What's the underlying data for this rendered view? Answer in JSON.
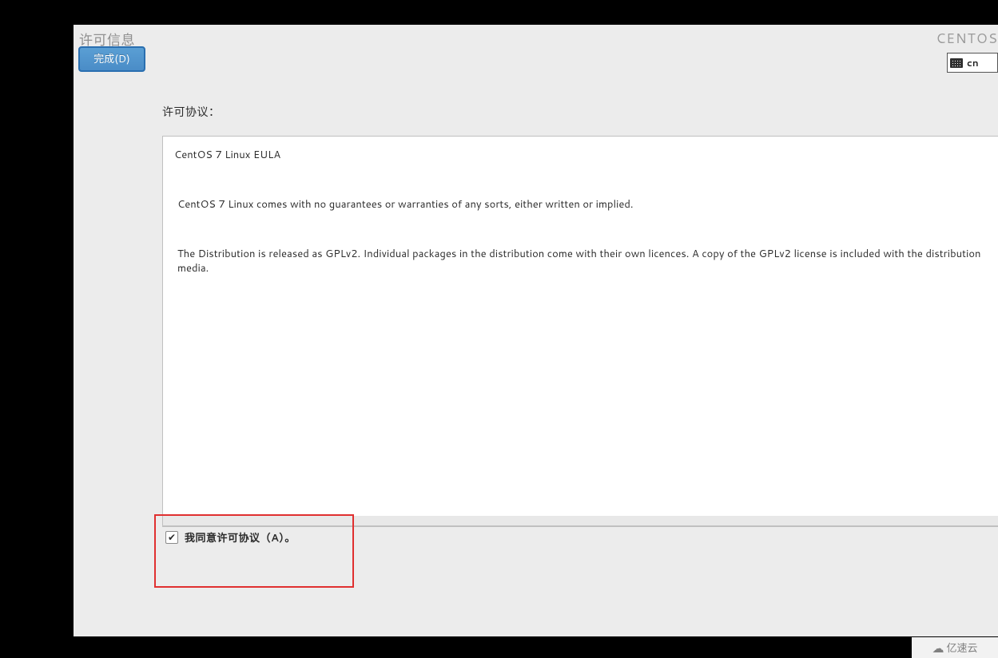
{
  "header": {
    "title": "许可信息",
    "done_button_label": "完成(D)",
    "brand": "CENTOS",
    "keyboard_layout": "cn"
  },
  "license": {
    "section_label": "许可协议：",
    "eula_title": "CentOS 7 Linux EULA",
    "paragraph1": "CentOS 7 Linux comes with no guarantees or warranties of any sorts, either written or implied.",
    "paragraph2": "The Distribution is released as GPLv2. Individual packages in the distribution come with their own licences. A copy of the GPLv2 license is included with the distribution media."
  },
  "consent": {
    "checkbox_checked": true,
    "checkbox_label": "我同意许可协议（A）。"
  },
  "watermark": {
    "text": "亿速云"
  }
}
